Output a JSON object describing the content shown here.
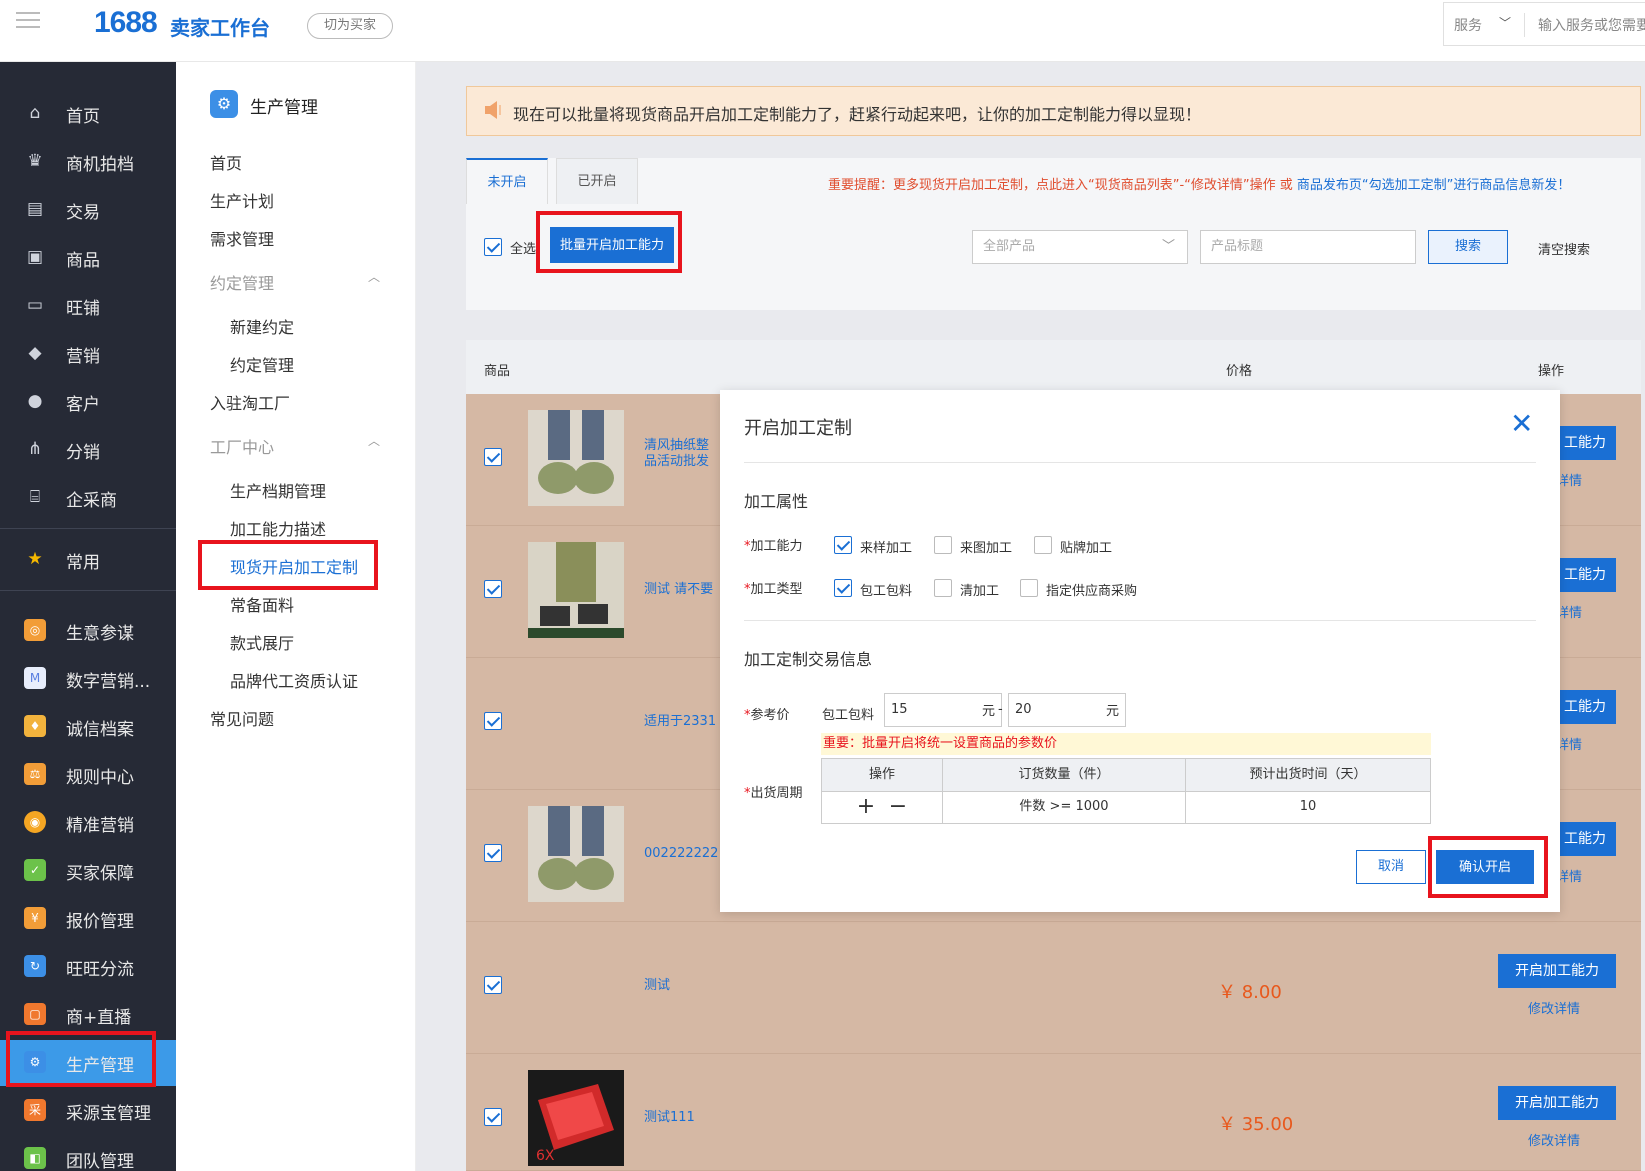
{
  "topbar": {
    "logo_number": "1688",
    "logo_text": "卖家工作台",
    "switch_label": "切为买家",
    "service_label": "服务",
    "search_placeholder": "输入服务或您需要"
  },
  "sidebar_dark": {
    "items": [
      {
        "label": "首页",
        "icon": "home-icon"
      },
      {
        "label": "商机拍档",
        "icon": "crown-icon"
      },
      {
        "label": "交易",
        "icon": "clipboard-icon"
      },
      {
        "label": "商品",
        "icon": "box-icon"
      },
      {
        "label": "旺铺",
        "icon": "store-icon"
      },
      {
        "label": "营销",
        "icon": "tag-icon"
      },
      {
        "label": "客户",
        "icon": "user-icon"
      },
      {
        "label": "分销",
        "icon": "share-icon"
      },
      {
        "label": "企采商",
        "icon": "building-icon"
      },
      {
        "label": "常用",
        "icon": "star-icon"
      },
      {
        "label": "生意参谋",
        "icon": "compass-app-icon",
        "color": "#f29d38"
      },
      {
        "label": "数字营销...",
        "icon": "m-app-icon",
        "color": "#e8eefc"
      },
      {
        "label": "诚信档案",
        "icon": "shield-app-icon",
        "color": "#f2b33d"
      },
      {
        "label": "规则中心",
        "icon": "scale-app-icon",
        "color": "#f29d38"
      },
      {
        "label": "精准营销",
        "icon": "target-app-icon",
        "color": "#f5a623"
      },
      {
        "label": "买家保障",
        "icon": "guard-app-icon",
        "color": "#6cc24a"
      },
      {
        "label": "报价管理",
        "icon": "quote-app-icon",
        "color": "#f29d38"
      },
      {
        "label": "旺旺分流",
        "icon": "chat-app-icon",
        "color": "#3c8fe6"
      },
      {
        "label": "商+直播",
        "icon": "live-app-icon",
        "color": "#f0782e"
      },
      {
        "label": "生产管理",
        "icon": "gear-app-icon",
        "color": "#3c8fe6"
      },
      {
        "label": "采源宝管理",
        "icon": "cai-app-icon",
        "color": "#f0782e"
      },
      {
        "label": "团队管理",
        "icon": "team-app-icon",
        "color": "#6cc24a"
      }
    ]
  },
  "sidebar_light": {
    "header": "生产管理",
    "items": [
      {
        "label": "首页"
      },
      {
        "label": "生产计划"
      },
      {
        "label": "需求管理"
      },
      {
        "label": "约定管理"
      },
      {
        "label": "新建约定"
      },
      {
        "label": "约定管理"
      },
      {
        "label": "入驻淘工厂"
      },
      {
        "label": "工厂中心"
      },
      {
        "label": "生产档期管理"
      },
      {
        "label": "加工能力描述"
      },
      {
        "label": "现货开启加工定制"
      },
      {
        "label": "常备面料"
      },
      {
        "label": "款式展厅"
      },
      {
        "label": "品牌代工资质认证"
      },
      {
        "label": "常见问题"
      }
    ]
  },
  "notice": {
    "text": "现在可以批量将现货商品开启加工定制能力了，赶紧行动起来吧，让你的加工定制能力得以显现！"
  },
  "tabs": {
    "not_open": "未开启",
    "opened": "已开启"
  },
  "reminder": {
    "part1": "重要提醒：更多现货开启加工定制，点此进入“现货商品列表”-“修改详情”操作 或",
    "part2": "商品发布页“勾选加工定制”进行商品信息新发！"
  },
  "toolbar": {
    "select_all": "全选",
    "batch_button": "批量开启加工能力",
    "product_select": "全部产品",
    "title_placeholder": "产品标题",
    "search": "搜索",
    "clear": "清空搜索"
  },
  "table": {
    "col_product": "商品",
    "col_price": "价格",
    "col_action": "操作",
    "open_label": "开启加工能力",
    "edit_label": "修改详情",
    "rows": [
      {
        "name": "清风抽纸整\n品活动批发",
        "price": "",
        "checked": true
      },
      {
        "name": "测试 请不要",
        "price": "",
        "checked": true
      },
      {
        "name": "适用于2331",
        "price": "",
        "checked": true
      },
      {
        "name": "002222222",
        "price": "",
        "checked": true
      },
      {
        "name": "测试",
        "price": "￥ 8.00",
        "checked": true
      },
      {
        "name": "测试111",
        "price": "￥ 35.00",
        "checked": true
      }
    ],
    "partial_open": "工能力",
    "partial_edit": "详情"
  },
  "modal": {
    "title": "开启加工定制",
    "section_attr": "加工属性",
    "capability_label": "加工能力",
    "capability_options": [
      {
        "label": "来样加工",
        "checked": true
      },
      {
        "label": "来图加工",
        "checked": false
      },
      {
        "label": "贴牌加工",
        "checked": false
      }
    ],
    "type_label": "加工类型",
    "type_options": [
      {
        "label": "包工包料",
        "checked": true
      },
      {
        "label": "清加工",
        "checked": false
      },
      {
        "label": "指定供应商采购",
        "checked": false
      }
    ],
    "section_trade": "加工定制交易信息",
    "ref_price_label": "参考价",
    "ref_price_type": "包工包料",
    "price_min": "15",
    "price_max": "20",
    "unit": "元",
    "dash": "-",
    "warning": "重要：批量开启将统一设置商品的参数价",
    "ship_label": "出货周期",
    "ship_cols": [
      "操作",
      "订货数量（件）",
      "预计出货时间（天）"
    ],
    "ship_row": {
      "qty": "件数 >= 1000",
      "days": "10"
    },
    "cancel": "取消",
    "confirm": "确认开启"
  }
}
